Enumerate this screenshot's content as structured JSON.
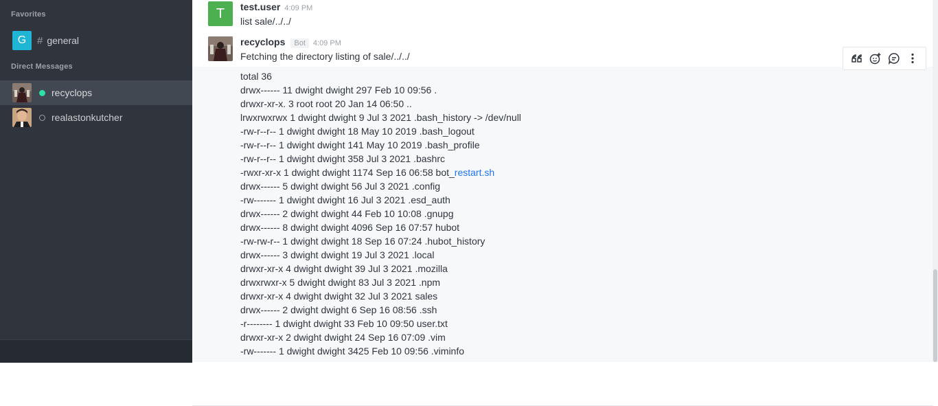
{
  "sidebar": {
    "favorites_title": "Favorites",
    "favorites": [
      {
        "avatar_letter": "G",
        "label": "general"
      }
    ],
    "dm_title": "Direct Messages",
    "direct_messages": [
      {
        "label": "recyclops",
        "status": "online"
      },
      {
        "label": "realastonkutcher",
        "status": "offline"
      }
    ]
  },
  "messages": [
    {
      "avatar_letter": "T",
      "username": "test.user",
      "time": "4:09 PM",
      "text": "list sale/../../"
    },
    {
      "username": "recyclops",
      "bot_tag": "Bot",
      "time": "4:09 PM",
      "text": "Fetching the directory listing of sale/../../"
    }
  ],
  "listing": [
    "total 36",
    "drwx------ 11 dwight dwight 297 Feb 10 09:56 .",
    "drwxr-xr-x. 3 root root 20 Jan 14 06:50 ..",
    "lrwxrwxrwx 1 dwight dwight 9 Jul 3 2021 .bash_history -> /dev/null",
    "-rw-r--r-- 1 dwight dwight 18 May 10 2019 .bash_logout",
    "-rw-r--r-- 1 dwight dwight 141 May 10 2019 .bash_profile",
    "-rw-r--r-- 1 dwight dwight 358 Jul 3 2021 .bashrc",
    "-rwxr-xr-x 1 dwight dwight 1174 Sep 16 06:58 bot_",
    "drwx------ 5 dwight dwight 56 Jul 3 2021 .config",
    "-rw------- 1 dwight dwight 16 Jul 3 2021 .esd_auth",
    "drwx------ 2 dwight dwight 44 Feb 10 10:08 .gnupg",
    "drwx------ 8 dwight dwight 4096 Sep 16 07:57 hubot",
    "-rw-rw-r-- 1 dwight dwight 18 Sep 16 07:24 .hubot_history",
    "drwx------ 3 dwight dwight 19 Jul 3 2021 .local",
    "drwxr-xr-x 4 dwight dwight 39 Jul 3 2021 .mozilla",
    "drwxrwxr-x 5 dwight dwight 83 Jul 3 2021 .npm",
    "drwxr-xr-x 4 dwight dwight 32 Jul 3 2021 sales",
    "drwx------ 2 dwight dwight 6 Sep 16 08:56 .ssh",
    "-r-------- 1 dwight dwight 33 Feb 10 09:50 user.txt",
    "drwxr-xr-x 2 dwight dwight 24 Sep 16 07:09 .vim",
    "-rw------- 1 dwight dwight 3425 Feb 10 09:56 .viminfo"
  ],
  "listing_link": "restart.sh",
  "toolbar": {
    "icons": [
      "quote-icon",
      "add-reaction-icon",
      "reply-in-thread-icon",
      "more-options-icon"
    ]
  },
  "colors": {
    "sidebar_bg": "#2f343d",
    "accent_link": "#1d74f5",
    "online": "#2de0a5",
    "general_avatar": "#1fb5d4",
    "testuser_avatar": "#4caf50"
  }
}
